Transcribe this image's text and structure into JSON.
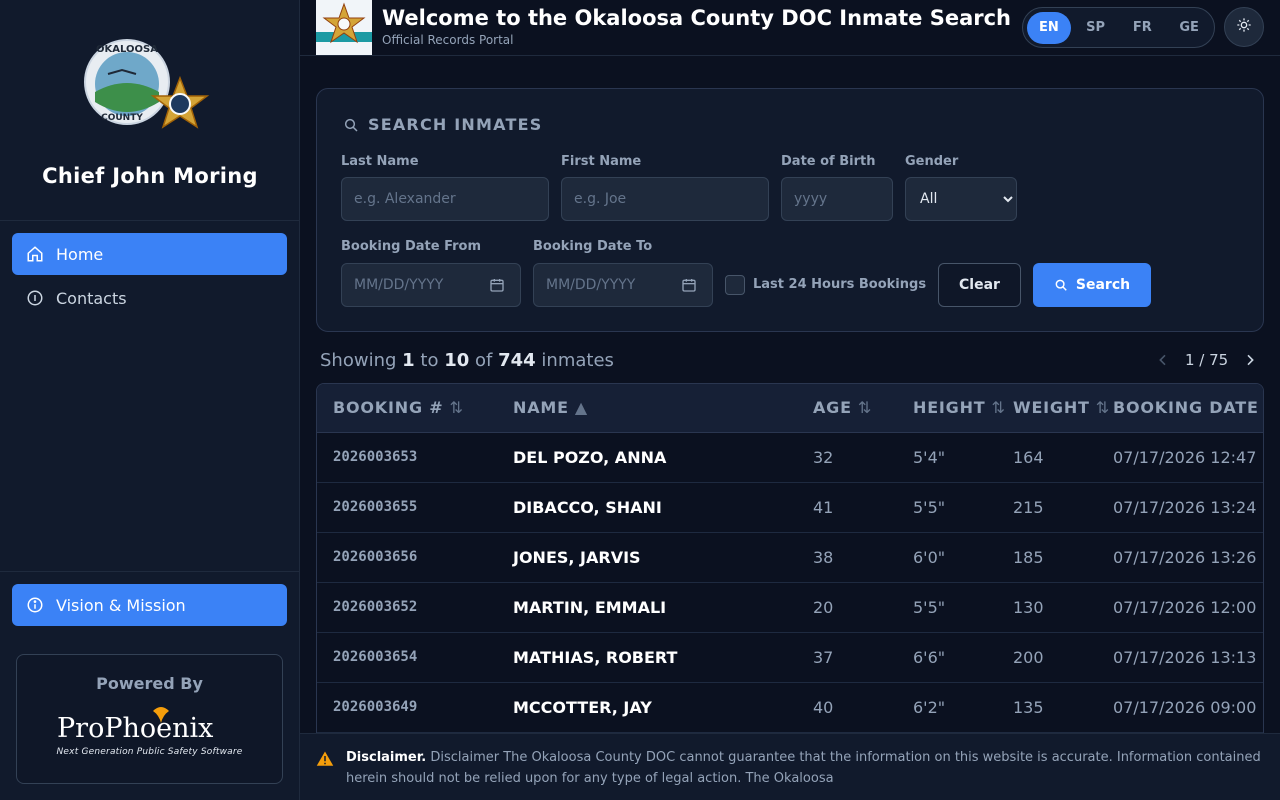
{
  "sidebar": {
    "logo_text_top": "OKALOOSA",
    "logo_text_bottom": "COUNTY",
    "chief_name": "Chief John Moring",
    "nav": [
      {
        "label": "Home",
        "icon": "home-icon"
      },
      {
        "label": "Contacts",
        "icon": "info-icon"
      }
    ],
    "vision_label": "Vision & Mission",
    "powered_by": "Powered By",
    "vendor_logo": "ProPhoenix",
    "vendor_tagline": "Next Generation Public Safety Software"
  },
  "header": {
    "title": "Welcome to the Okaloosa County DOC Inmate Search",
    "subtitle": "Official Records Portal",
    "languages": [
      "EN",
      "SP",
      "FR",
      "GE"
    ],
    "active_language": "EN",
    "theme_icon": "sun-icon"
  },
  "search": {
    "title": "SEARCH INMATES",
    "last_name_label": "Last Name",
    "last_name_placeholder": "e.g. Alexander",
    "first_name_label": "First Name",
    "first_name_placeholder": "e.g. Joe",
    "dob_label": "Date of Birth",
    "dob_placeholder": "yyyy",
    "gender_label": "Gender",
    "gender_value": "All",
    "booking_from_label": "Booking Date From",
    "booking_from_placeholder": "MM/DD/YYYY",
    "booking_to_label": "Booking Date To",
    "booking_to_placeholder": "MM/DD/YYYY",
    "last24_label": "Last 24 Hours Bookings",
    "clear_label": "Clear",
    "search_label": "Search"
  },
  "results": {
    "showing_prefix": "Showing",
    "from": "1",
    "to_word": "to",
    "to": "10",
    "of_word": "of",
    "total": "744",
    "suffix": "inmates",
    "page": "1 / 75"
  },
  "table": {
    "headers": [
      "BOOKING #",
      "NAME",
      "AGE",
      "HEIGHT",
      "WEIGHT",
      "BOOKING DATE"
    ],
    "sort_icons": [
      "⇅",
      "▲",
      "⇅",
      "⇅",
      "⇅",
      ""
    ],
    "rows": [
      {
        "booking": "2026003653",
        "name": "DEL POZO, ANNA",
        "age": "32",
        "height": "5'4\"",
        "weight": "164",
        "date": "07/17/2026 12:47"
      },
      {
        "booking": "2026003655",
        "name": "DIBACCO, SHANI",
        "age": "41",
        "height": "5'5\"",
        "weight": "215",
        "date": "07/17/2026 13:24"
      },
      {
        "booking": "2026003656",
        "name": "JONES, JARVIS",
        "age": "38",
        "height": "6'0\"",
        "weight": "185",
        "date": "07/17/2026 13:26"
      },
      {
        "booking": "2026003652",
        "name": "MARTIN, EMMALI",
        "age": "20",
        "height": "5'5\"",
        "weight": "130",
        "date": "07/17/2026 12:00"
      },
      {
        "booking": "2026003654",
        "name": "MATHIAS, ROBERT",
        "age": "37",
        "height": "6'6\"",
        "weight": "200",
        "date": "07/17/2026 13:13"
      },
      {
        "booking": "2026003649",
        "name": "MCCOTTER, JAY",
        "age": "40",
        "height": "6'2\"",
        "weight": "135",
        "date": "07/17/2026 09:00"
      }
    ]
  },
  "disclaimer": {
    "label": "Disclaimer.",
    "text": "Disclaimer The Okaloosa County DOC cannot guarantee that the information on this website is accurate. Information contained herein should not be relied upon for any type of legal action. The Okaloosa"
  },
  "colors": {
    "accent": "#3b82f6",
    "background": "#0b1120",
    "panel": "#111a2c",
    "warning": "#f59e0b"
  }
}
